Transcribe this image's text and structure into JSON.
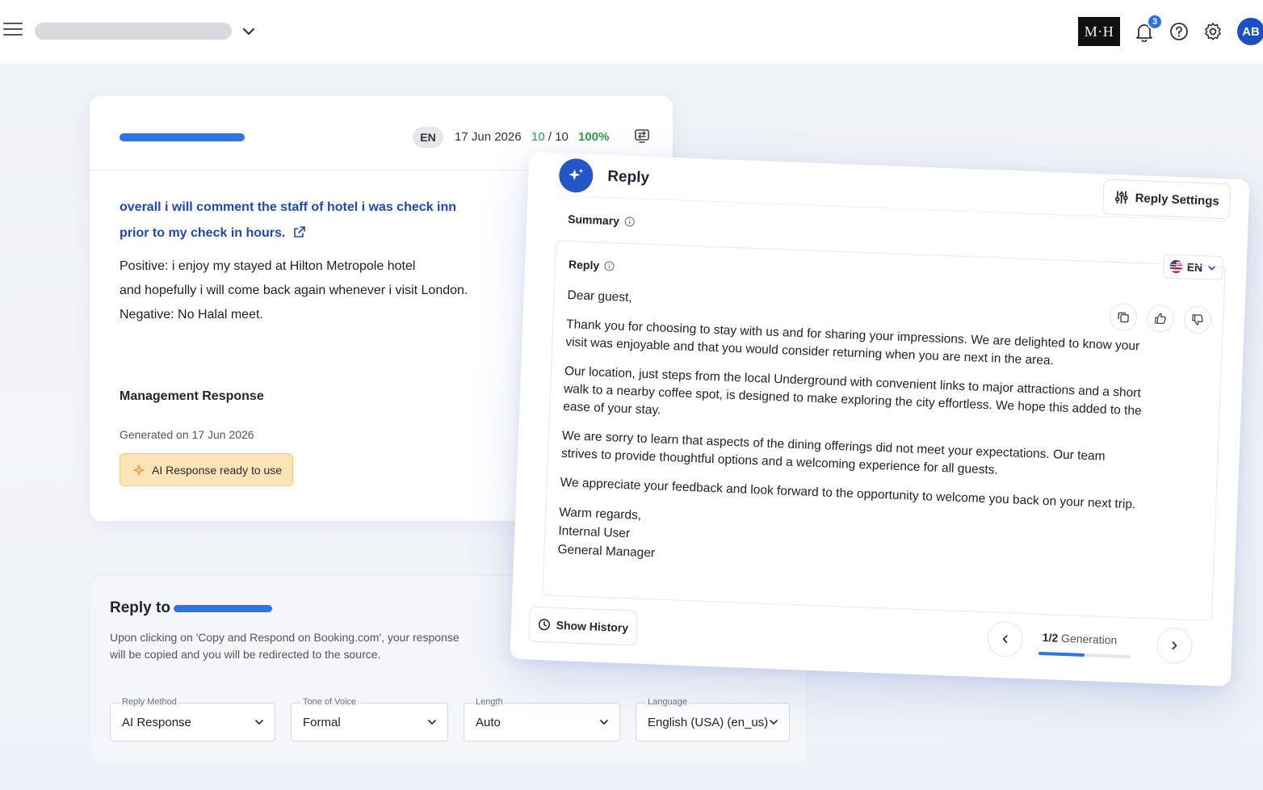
{
  "topbar": {
    "logo_text": "M·H",
    "notification_count": "3",
    "avatar_initials": "AB"
  },
  "review": {
    "language": "EN",
    "date": "17 Jun 2026",
    "score_value": "10",
    "score_sep": " / 10",
    "percent": "100%",
    "title_line1": "overall i will comment the staff of hotel i was check inn",
    "title_line2": "prior to my check in hours.",
    "positive": "Positive: i enjoy my stayed at Hilton Metropole hotel",
    "positive_cont": "and hopefully i will come back again whenever i visit London.",
    "negative": "Negative: No Halal meet.",
    "management_title": "Management Response",
    "generated": "Generated on 17 Jun 2026",
    "ai_ready": "AI Response ready to use"
  },
  "reply_to": {
    "title": "Reply to",
    "description": "Upon clicking on 'Copy and Respond on Booking.com', your response will be copied and you will be redirected to the source.",
    "fields": [
      {
        "label": "Reply Method",
        "value": "AI Response"
      },
      {
        "label": "Tone of Voice",
        "value": "Formal"
      },
      {
        "label": "Length",
        "value": "Auto"
      },
      {
        "label": "Language",
        "value": "English (USA) (en_us)"
      }
    ]
  },
  "reply_panel": {
    "heading": "Reply",
    "settings_label": "Reply Settings",
    "summary_label": "Summary",
    "lang_code": "EN",
    "reply_label": "Reply",
    "greeting": "Dear guest,",
    "paragraphs": [
      "Thank you for choosing to stay with us and for sharing your impressions. We are delighted to know your visit was enjoyable and that you would consider returning when you are next in the area.",
      "Our location, just steps from the local Underground with convenient links to major attractions and a short walk to a nearby coffee spot, is designed to make exploring the city effortless. We hope this added to the ease of your stay.",
      "We are sorry to learn that aspects of the dining offerings did not meet your expectations. Our team strives to provide thoughtful options and a welcoming experience for all guests.",
      "We appreciate your feedback and look forward to the opportunity to welcome you back on your next trip."
    ],
    "closing": "Warm regards,",
    "signer_name": "Internal User",
    "signer_title": "General Manager",
    "show_history": "Show History",
    "gen_current": "1/2",
    "gen_word": " Generation",
    "gen_progress": 0.5
  },
  "colors": {
    "accent": "#2f74e6",
    "brand_dark": "#2456c7",
    "success": "#2c9a4a",
    "ai_pill_bg": "#fde3b8"
  },
  "icons": [
    "menu-icon",
    "chevron-down-icon",
    "bell-icon",
    "help-icon",
    "gear-icon",
    "translate-icon",
    "external-link-icon",
    "sparkle-icon",
    "sliders-icon",
    "info-icon",
    "copy-icon",
    "thumbs-up-icon",
    "thumbs-down-icon",
    "clock-icon",
    "chevron-left-icon",
    "chevron-right-icon"
  ]
}
